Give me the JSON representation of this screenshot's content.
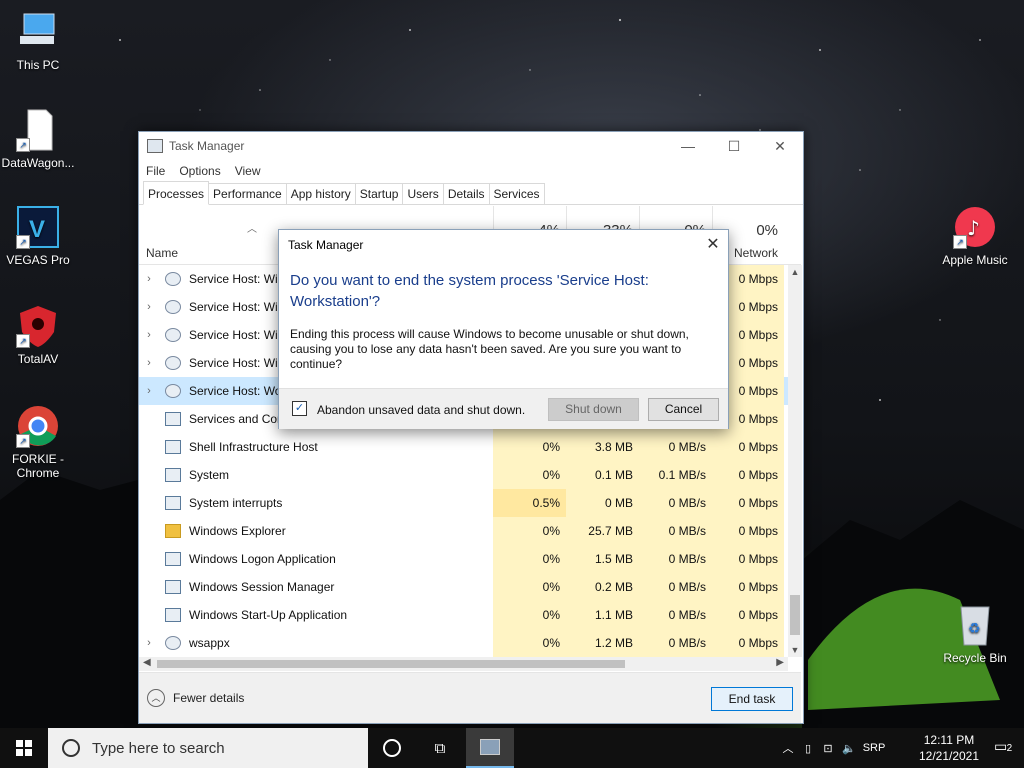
{
  "desktop": {
    "icons": [
      {
        "label": "This PC"
      },
      {
        "label": "DataWagon..."
      },
      {
        "label": "VEGAS Pro"
      },
      {
        "label": "TotalAV"
      },
      {
        "label": "FORKIE - Chrome"
      },
      {
        "label": "Apple Music"
      },
      {
        "label": "Recycle Bin"
      }
    ]
  },
  "taskmgr": {
    "title": "Task Manager",
    "menu": [
      "File",
      "Options",
      "View"
    ],
    "tabs": [
      "Processes",
      "Performance",
      "App history",
      "Startup",
      "Users",
      "Details",
      "Services"
    ],
    "active_tab": "Processes",
    "columns": {
      "name": "Name",
      "cpu_pct": "4%",
      "mem_pct": "33%",
      "disk_pct": "0%",
      "net_pct": "0%",
      "network_label": "Network"
    },
    "rows": [
      {
        "name": "Service Host: Wir",
        "expand": true,
        "icon": "gear",
        "net": "0 Mbps"
      },
      {
        "name": "Service Host: Wir",
        "expand": true,
        "icon": "gear",
        "net": "0 Mbps"
      },
      {
        "name": "Service Host: Wir",
        "expand": true,
        "icon": "gear",
        "net": "0 Mbps"
      },
      {
        "name": "Service Host: Wir",
        "expand": true,
        "icon": "gear",
        "net": "0 Mbps"
      },
      {
        "name": "Service Host: Wo",
        "expand": true,
        "icon": "gear",
        "net": "0 Mbps",
        "selected": true
      },
      {
        "name": "Services and Con",
        "expand": false,
        "icon": "window",
        "net": "0 Mbps"
      },
      {
        "name": "Shell Infrastructure Host",
        "expand": false,
        "icon": "window",
        "cpu": "0%",
        "mem": "3.8 MB",
        "disk": "0 MB/s",
        "net": "0 Mbps"
      },
      {
        "name": "System",
        "expand": false,
        "icon": "window",
        "cpu": "0%",
        "mem": "0.1 MB",
        "disk": "0.1 MB/s",
        "net": "0 Mbps"
      },
      {
        "name": "System interrupts",
        "expand": false,
        "icon": "window",
        "cpu": "0.5%",
        "mem": "0 MB",
        "disk": "0 MB/s",
        "net": "0 Mbps",
        "hot": true
      },
      {
        "name": "Windows Explorer",
        "expand": false,
        "icon": "folder",
        "cpu": "0%",
        "mem": "25.7 MB",
        "disk": "0 MB/s",
        "net": "0 Mbps"
      },
      {
        "name": "Windows Logon Application",
        "expand": false,
        "icon": "window",
        "cpu": "0%",
        "mem": "1.5 MB",
        "disk": "0 MB/s",
        "net": "0 Mbps"
      },
      {
        "name": "Windows Session Manager",
        "expand": false,
        "icon": "window",
        "cpu": "0%",
        "mem": "0.2 MB",
        "disk": "0 MB/s",
        "net": "0 Mbps"
      },
      {
        "name": "Windows Start-Up Application",
        "expand": false,
        "icon": "window",
        "cpu": "0%",
        "mem": "1.1 MB",
        "disk": "0 MB/s",
        "net": "0 Mbps"
      },
      {
        "name": "wsappx",
        "expand": true,
        "icon": "gear",
        "cpu": "0%",
        "mem": "1.2 MB",
        "disk": "0 MB/s",
        "net": "0 Mbps"
      }
    ],
    "fewer_details": "Fewer details",
    "end_task": "End task"
  },
  "dialog": {
    "title": "Task Manager",
    "heading": "Do you want to end the system process 'Service Host: Workstation'?",
    "body": "Ending this process will cause Windows to become unusable or shut down, causing you to lose any data hasn't been saved. Are you sure you want to continue?",
    "checkbox_label": "Abandon unsaved data and shut down.",
    "checkbox_checked": true,
    "shutdown_label": "Shut down",
    "cancel_label": "Cancel"
  },
  "taskbar": {
    "search_placeholder": "Type here to search",
    "language": "SRP",
    "time": "12:11 PM",
    "date": "12/21/2021",
    "notifications": "2"
  }
}
